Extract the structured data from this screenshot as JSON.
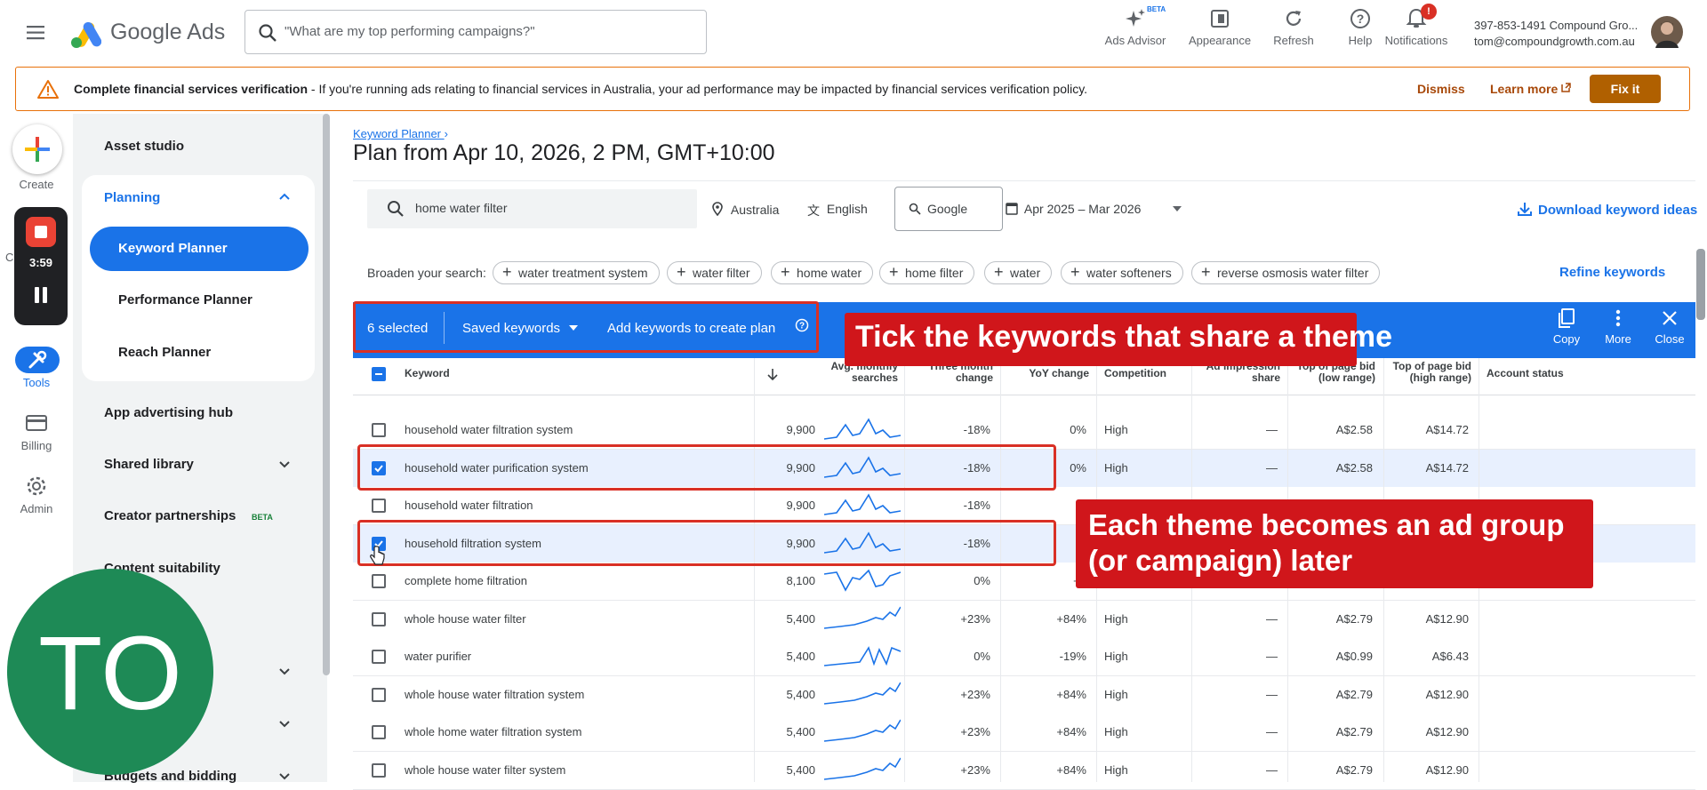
{
  "header": {
    "app_name": "Google Ads",
    "search_placeholder": "\"What are my top performing campaigns?\"",
    "buttons": [
      {
        "label": "Ads Advisor",
        "icon": "sparkle-icon",
        "badge": "BETA"
      },
      {
        "label": "Appearance",
        "icon": "appearance-icon"
      },
      {
        "label": "Refresh",
        "icon": "refresh-icon"
      },
      {
        "label": "Help",
        "icon": "help-icon"
      },
      {
        "label": "Notifications",
        "icon": "bell-icon",
        "badge": "!"
      }
    ],
    "account_id": "397-853-1491 Compound Gro...",
    "account_email": "tom@compoundgrowth.com.au"
  },
  "banner": {
    "title": "Complete financial services verification",
    "message": " - If you're running ads relating to financial services in Australia, your ad performance may be impacted by financial services verification policy.",
    "dismiss": "Dismiss",
    "learn_more": "Learn more",
    "fix": "Fix it"
  },
  "rail": {
    "create": "Create",
    "recording_time": "3:59",
    "cut_label": "C",
    "tools": "Tools",
    "billing": "Billing",
    "admin": "Admin"
  },
  "sidenav": {
    "asset_studio": "Asset studio",
    "planning": "Planning",
    "keyword_planner": "Keyword Planner",
    "performance_planner": "Performance Planner",
    "reach_planner": "Reach Planner",
    "app_hub": "App advertising hub",
    "shared_library": "Shared library",
    "creator": "Creator partnerships",
    "creator_badge": "BETA",
    "content_suitability": "Content suitability",
    "budgets": "Budgets and bidding"
  },
  "avatar_initials": "TO",
  "main": {
    "breadcrumb": "Keyword Planner",
    "title": "Plan from Apr 10, 2026, 2 PM, GMT+10:00",
    "search_value": "home water filter",
    "location": "Australia",
    "language": "English",
    "network": "Google",
    "date_range": "Apr 2025 – Mar 2026",
    "download": "Download keyword ideas",
    "broaden_label": "Broaden your search:",
    "broaden_chips": [
      "water treatment system",
      "water filter",
      "home water",
      "home filter",
      "water",
      "water softeners",
      "reverse osmosis water filter"
    ],
    "refine": "Refine keywords"
  },
  "selection": {
    "count": "6 selected",
    "saved": "Saved keywords",
    "add": "Add keywords to create plan",
    "copy": "Copy",
    "more": "More",
    "close": "Close"
  },
  "callouts": {
    "tick": "Tick the keywords that share a theme",
    "theme": "Each theme becomes an ad group (or campaign) later"
  },
  "table": {
    "headers": {
      "keyword": "Keyword",
      "avg_line1": "Avg. monthly",
      "avg_line2": "searches",
      "three_line1": "Three month",
      "three_line2": "change",
      "yoy": "YoY change",
      "competition": "Competition",
      "impr_line1": "Ad impression",
      "impr_line2": "share",
      "low_line1": "Top of page bid",
      "low_line2": "(low range)",
      "high_line1": "Top of page bid",
      "high_line2": "(high range)",
      "status": "Account status"
    },
    "rows": [
      {
        "keyword": "household water filtration system",
        "avg": "9,900",
        "three": "-18%",
        "yoy": "0%",
        "comp": "High",
        "impr": "—",
        "low": "A$2.58",
        "high": "A$14.72",
        "checked": false
      },
      {
        "keyword": "household water purification system",
        "avg": "9,900",
        "three": "-18%",
        "yoy": "0%",
        "comp": "High",
        "impr": "—",
        "low": "A$2.58",
        "high": "A$14.72",
        "checked": true
      },
      {
        "keyword": "household water filtration",
        "avg": "9,900",
        "three": "-18%",
        "yoy": "",
        "comp": "",
        "impr": "",
        "low": "",
        "high": "",
        "checked": false
      },
      {
        "keyword": "household filtration system",
        "avg": "9,900",
        "three": "-18%",
        "yoy": "",
        "comp": "",
        "impr": "",
        "low": "",
        "high": "",
        "checked": true
      },
      {
        "keyword": "complete home filtration",
        "avg": "8,100",
        "three": "0%",
        "yoy": "+2",
        "comp": "",
        "impr": "",
        "low": "",
        "high": "",
        "checked": false
      },
      {
        "keyword": "whole house water filter",
        "avg": "5,400",
        "three": "+23%",
        "yoy": "+84%",
        "comp": "High",
        "impr": "—",
        "low": "A$2.79",
        "high": "A$12.90",
        "checked": false
      },
      {
        "keyword": "water purifier",
        "avg": "5,400",
        "three": "0%",
        "yoy": "-19%",
        "comp": "High",
        "impr": "—",
        "low": "A$0.99",
        "high": "A$6.43",
        "checked": false
      },
      {
        "keyword": "whole house water filtration system",
        "avg": "5,400",
        "three": "+23%",
        "yoy": "+84%",
        "comp": "High",
        "impr": "—",
        "low": "A$2.79",
        "high": "A$12.90",
        "checked": false
      },
      {
        "keyword": "whole home water filtration system",
        "avg": "5,400",
        "three": "+23%",
        "yoy": "+84%",
        "comp": "High",
        "impr": "—",
        "low": "A$2.79",
        "high": "A$12.90",
        "checked": false
      },
      {
        "keyword": "whole house water filter system",
        "avg": "5,400",
        "three": "+23%",
        "yoy": "+84%",
        "comp": "High",
        "impr": "—",
        "low": "A$2.79",
        "high": "A$12.90",
        "checked": false
      }
    ]
  },
  "colors": {
    "accent": "#1a73e8",
    "callout": "#d0161b",
    "warning": "#e8710a",
    "avatar": "#1e8a56"
  }
}
